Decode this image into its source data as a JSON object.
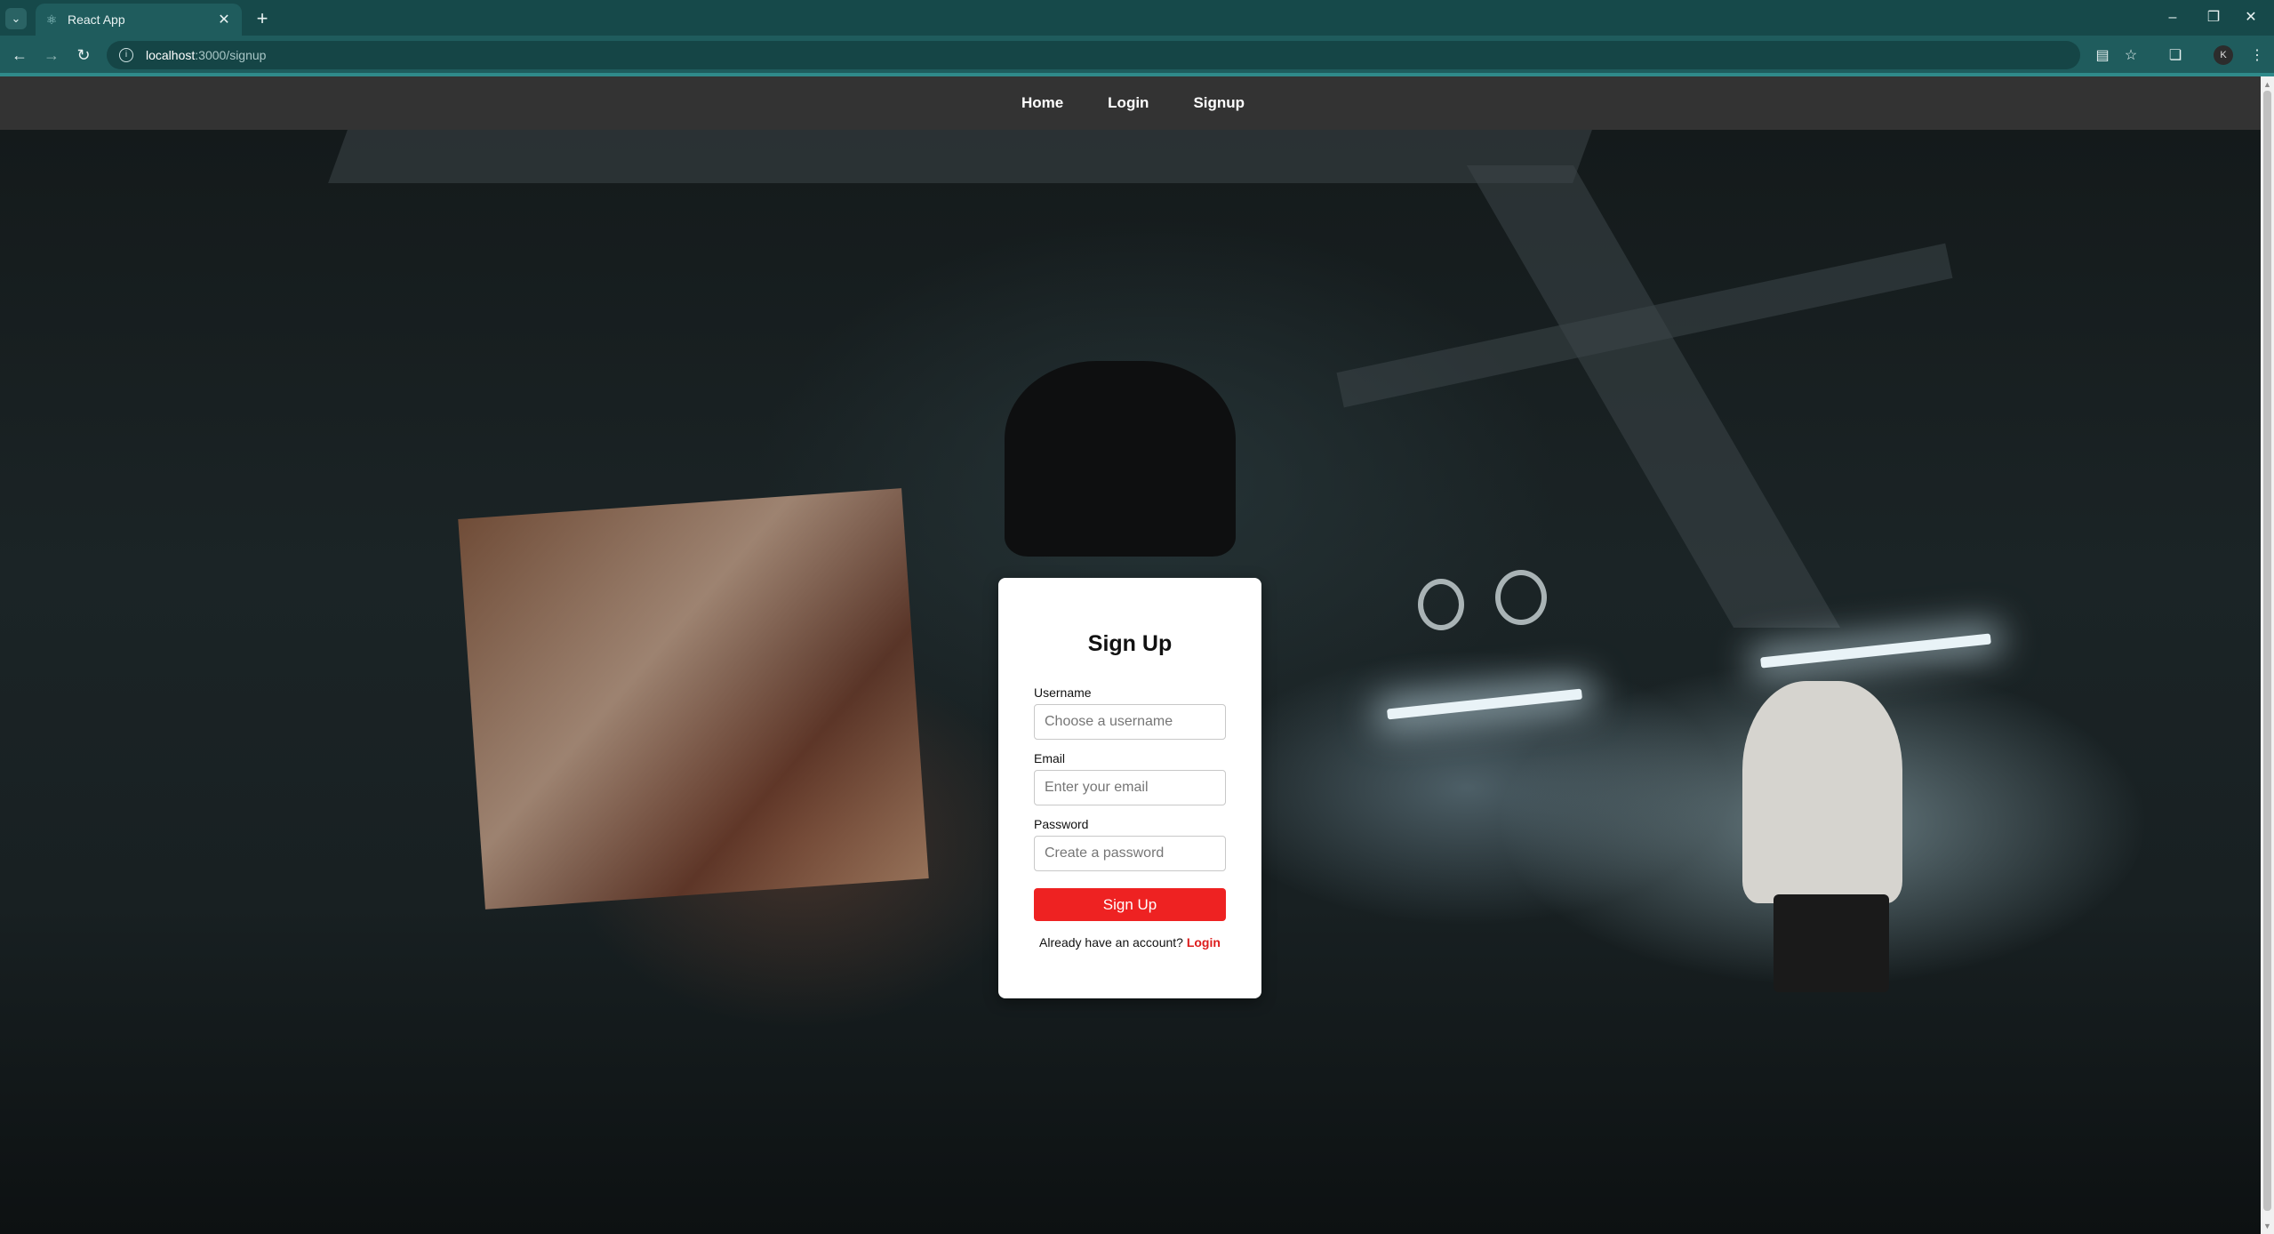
{
  "browser": {
    "tab_title": "React App",
    "url_host": "localhost",
    "url_path": ":3000/signup",
    "profile_initial": "K",
    "accent_color": "#1f5c5d"
  },
  "nav": {
    "links": [
      "Home",
      "Login",
      "Signup"
    ]
  },
  "form": {
    "title": "Sign Up",
    "username": {
      "label": "Username",
      "placeholder": "Choose a username"
    },
    "email": {
      "label": "Email",
      "placeholder": "Enter your email"
    },
    "password": {
      "label": "Password",
      "placeholder": "Create a password"
    },
    "submit_label": "Sign Up",
    "footer_text": "Already have an account?",
    "footer_link": "Login",
    "button_color": "#ee2222"
  },
  "icons": {
    "tab_menu": "chevron-down-icon",
    "favicon": "react-icon",
    "tab_close": "close-icon",
    "new_tab": "plus-icon",
    "back": "arrow-left-icon",
    "forward": "arrow-right-icon",
    "reload": "reload-icon",
    "site_info": "info-icon",
    "install": "install-app-icon",
    "bookmark": "star-icon",
    "extensions": "puzzle-icon",
    "menu": "kebab-menu-icon"
  }
}
